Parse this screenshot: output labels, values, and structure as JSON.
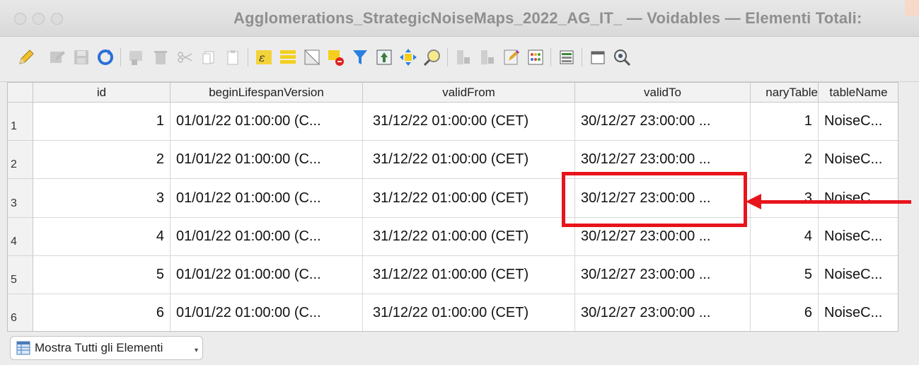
{
  "window": {
    "title": "Agglomerations_StrategicNoiseMaps_2022_AG_IT_ — Voidables — Elementi Totali:"
  },
  "toolbar": {
    "icons": [
      "pencil-edit-icon",
      "multi-edit-icon",
      "save-icon",
      "reload-icon",
      "add-feature-icon",
      "delete-feature-icon",
      "cut-icon",
      "copy-icon",
      "paste-icon",
      "expression-select-icon",
      "select-all-icon",
      "invert-selection-icon",
      "deselect-icon",
      "filter-icon",
      "move-to-top-icon",
      "pan-to-selected-icon",
      "zoom-to-selected-icon",
      "new-field-icon",
      "delete-field-icon",
      "field-calculator-icon",
      "conditional-formatting-icon",
      "organize-columns-icon",
      "dock-icon",
      "actions-icon"
    ]
  },
  "table": {
    "columns": [
      "id",
      "beginLifespanVersion",
      "validFrom",
      "validTo",
      "naryTable",
      "tableName"
    ],
    "rows": [
      {
        "n": "1",
        "id": "1",
        "begin": "01/01/22 01:00:00 (C...",
        "from": "31/12/22 01:00:00 (CET)",
        "to": "30/12/27 23:00:00 ...",
        "prim": "1",
        "name": "NoiseC..."
      },
      {
        "n": "2",
        "id": "2",
        "begin": "01/01/22 01:00:00 (C...",
        "from": "31/12/22 01:00:00 (CET)",
        "to": "30/12/27 23:00:00 ...",
        "prim": "2",
        "name": "NoiseC..."
      },
      {
        "n": "3",
        "id": "3",
        "begin": "01/01/22 01:00:00 (C...",
        "from": "31/12/22 01:00:00 (CET)",
        "to": "30/12/27 23:00:00 ...",
        "prim": "3",
        "name": "NoiseC..."
      },
      {
        "n": "4",
        "id": "4",
        "begin": "01/01/22 01:00:00 (C...",
        "from": "31/12/22 01:00:00 (CET)",
        "to": "30/12/27 23:00:00 ...",
        "prim": "4",
        "name": "NoiseC..."
      },
      {
        "n": "5",
        "id": "5",
        "begin": "01/01/22 01:00:00 (C...",
        "from": "31/12/22 01:00:00 (CET)",
        "to": "30/12/27 23:00:00 ...",
        "prim": "5",
        "name": "NoiseC..."
      },
      {
        "n": "6",
        "id": "6",
        "begin": "01/01/22 01:00:00 (C...",
        "from": "31/12/22 01:00:00 (CET)",
        "to": "30/12/27 23:00:00 ...",
        "prim": "6",
        "name": "NoiseC..."
      }
    ]
  },
  "annotation": {
    "color": "#e8141b",
    "highlighted_cell": "30/12/27 23:00:00 ..."
  },
  "footer": {
    "show_all_label": "Mostra Tutti gli Elementi"
  }
}
